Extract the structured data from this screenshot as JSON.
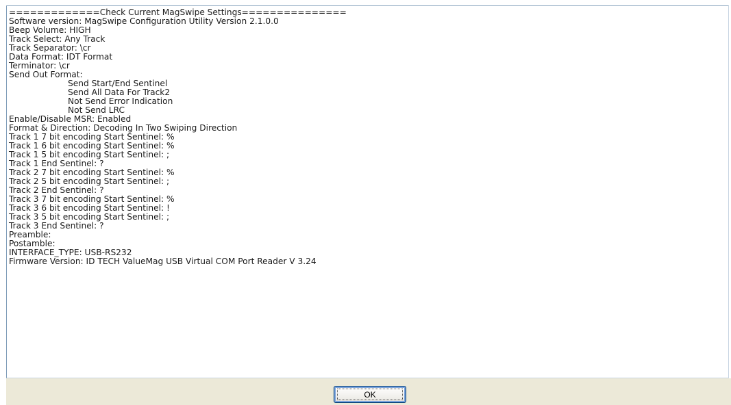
{
  "output": {
    "lines": [
      {
        "text": "=============Check Current MagSwipe Settings===============",
        "indent": false
      },
      {
        "text": "Software version: MagSwipe Configuration Utility Version 2.1.0.0",
        "indent": false
      },
      {
        "text": "Beep Volume: HIGH",
        "indent": false
      },
      {
        "text": "Track Select: Any Track",
        "indent": false
      },
      {
        "text": "Track Separator: \\cr",
        "indent": false
      },
      {
        "text": "Data Format: IDT Format",
        "indent": false
      },
      {
        "text": "Terminator: \\cr",
        "indent": false
      },
      {
        "text": "Send Out Format:",
        "indent": false
      },
      {
        "text": "Send Start/End Sentinel",
        "indent": true
      },
      {
        "text": "Send All Data For Track2",
        "indent": true
      },
      {
        "text": "Not Send Error Indication",
        "indent": true
      },
      {
        "text": "Not Send LRC",
        "indent": true
      },
      {
        "text": "Enable/Disable MSR: Enabled",
        "indent": false
      },
      {
        "text": "Format & Direction: Decoding In Two Swiping Direction",
        "indent": false
      },
      {
        "text": "Track 1 7 bit encoding Start Sentinel: %",
        "indent": false
      },
      {
        "text": "Track 1 6 bit encoding Start Sentinel: %",
        "indent": false
      },
      {
        "text": "Track 1 5 bit encoding Start Sentinel: ;",
        "indent": false
      },
      {
        "text": "Track 1 End Sentinel: ?",
        "indent": false
      },
      {
        "text": "Track 2 7 bit encoding Start Sentinel: %",
        "indent": false
      },
      {
        "text": "Track 2 5 bit encoding Start Sentinel: ;",
        "indent": false
      },
      {
        "text": "Track 2 End Sentinel: ?",
        "indent": false
      },
      {
        "text": "Track 3 7 bit encoding Start Sentinel: %",
        "indent": false
      },
      {
        "text": "Track 3 6 bit encoding Start Sentinel: !",
        "indent": false
      },
      {
        "text": "Track 3 5 bit encoding Start Sentinel: ;",
        "indent": false
      },
      {
        "text": "Track 3 End Sentinel: ?",
        "indent": false
      },
      {
        "text": "Preamble:",
        "indent": false
      },
      {
        "text": "Postamble:",
        "indent": false
      },
      {
        "text": "INTERFACE_TYPE: USB-RS232",
        "indent": false
      },
      {
        "text": "Firmware Version: ID TECH ValueMag USB Virtual COM Port Reader V 3.24",
        "indent": false
      }
    ]
  },
  "buttons": {
    "ok_label": "OK"
  },
  "colors": {
    "dialog_face": "#ece9d8",
    "field_border": "#7f9db9",
    "button_border": "#003c74"
  }
}
